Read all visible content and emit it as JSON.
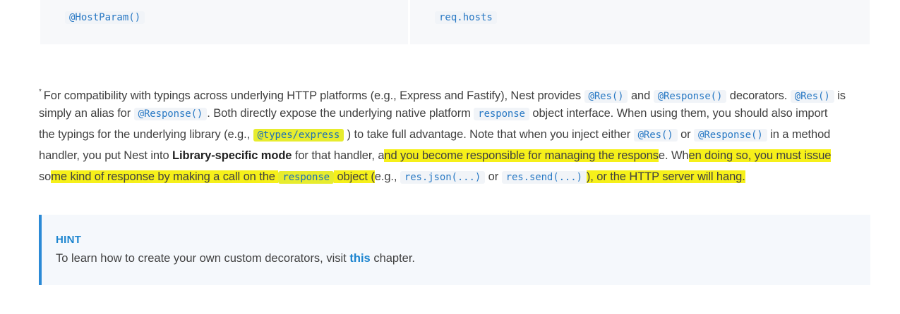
{
  "table_row": {
    "left_code": "@HostParam()",
    "right_code": "req.hosts"
  },
  "paragraph": {
    "footnote_mark": "*",
    "l1_t1": "For compatibility with typings across underlying HTTP platforms (e.g., Express and Fastify), Nest provides",
    "l1_c1": "@Res()",
    "l1_t2": "and",
    "l1_c2": "@Response()",
    "l1_t3": "decorators.",
    "l1_c3": "@Res()",
    "l1_t4": "is",
    "l2_t1": "simply an alias for",
    "l2_c1": "@Response()",
    "l2_t2": ". Both directly expose the underlying native platform",
    "l2_c2": "response",
    "l2_t3": "object interface. When using them, you should also import",
    "l3_t1": "the typings for the underlying library (e.g.,",
    "l3_c1": "@types/express",
    "l3_t2": ") to take full advantage. Note that when you inject either",
    "l3_c2": "@Res()",
    "l3_t3": "or",
    "l3_c3": "@Response()",
    "l3_t4": "in a method",
    "l4_t1": "handler, you put Nest into",
    "l4_bold": "Library-specific mode",
    "l4_t2": "for that handler, a",
    "l4_h1": "nd you become responsible for managing the respons",
    "l4_t3": "e. Wh",
    "l4_h2": "en doing so, you must issue",
    "l5_t1": "so",
    "l5_h1": "me kind of response by making a call on the",
    "l5_c1": "response",
    "l5_t2": "object (",
    "l5_t3": "e.g.,",
    "l5_c2": "res.json(...)",
    "l5_t4": "or",
    "l5_c3": "res.send(...)",
    "l5_h2": "), or the HTTP server will hang."
  },
  "hint": {
    "title": "HINT",
    "text_before": "To learn how to create your own custom decorators, visit",
    "link": "this",
    "text_after": "chapter."
  },
  "colors": {
    "accent": "#1b84cf",
    "highlight": "#f6f01a",
    "code_text": "#2979c4",
    "hint_bg": "#f5f8fc"
  }
}
